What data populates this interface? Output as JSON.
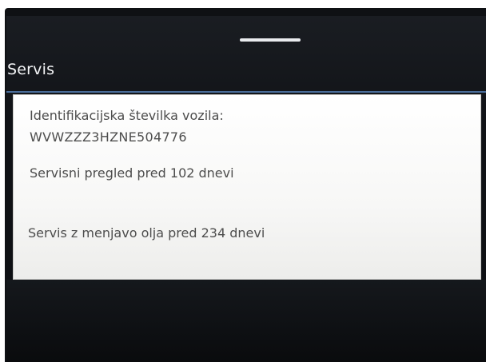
{
  "header": {
    "title": "Servis"
  },
  "panel": {
    "vin_label": "Identifikacijska številka vozila:",
    "vin_value": "WVWZZZ3HZNE504776",
    "inspection_text": "Servisni pregled pred 102 dnevi",
    "oil_service_text": "Servis z menjavo olja pred 234 dnevi"
  },
  "colors": {
    "screen_background": "#111317",
    "title_text": "#f4f5f7",
    "accent_line": "#4a6d9a",
    "panel_background": "#f7f7f6",
    "panel_text": "#4d4d4d",
    "handle": "#e9ebee"
  }
}
